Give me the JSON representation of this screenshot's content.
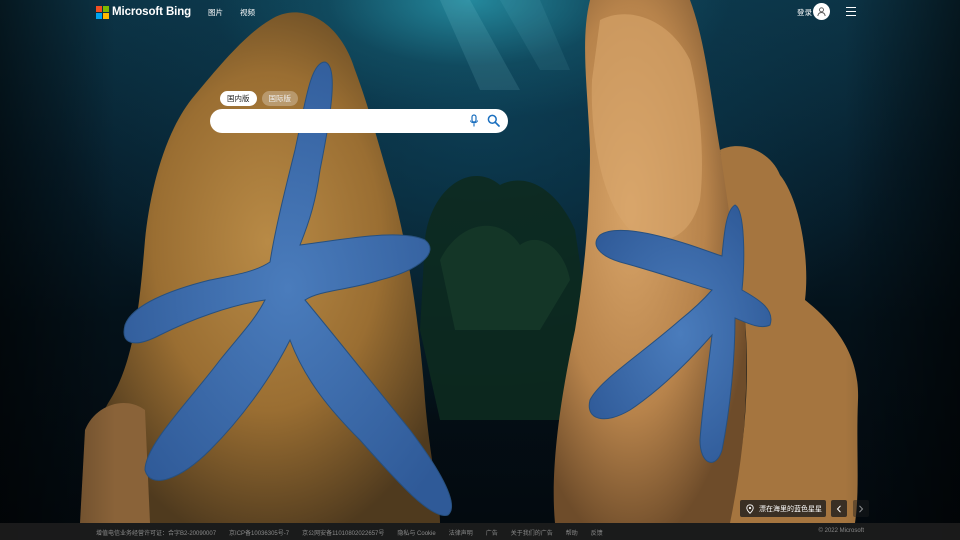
{
  "header": {
    "logo_text": "Microsoft Bing",
    "nav": [
      "图片",
      "视频"
    ],
    "signin_label": "登录",
    "menu_icon": "hamburger-icon",
    "avatar_icon": "user-icon"
  },
  "search": {
    "scope_tabs": [
      "国内版",
      "国际版"
    ],
    "active_scope": "国内版",
    "query": "",
    "mic_icon": "microphone-icon",
    "search_icon": "search-icon"
  },
  "image_info": {
    "caption": "漂在海里的蓝色星星",
    "location_icon": "location-pin-icon",
    "prev_icon": "chevron-left-icon",
    "next_icon": "chevron-right-icon"
  },
  "footer": {
    "links": [
      "增值电信业务经营许可证：合字B2-20090007",
      "京ICP备10036305号-7",
      "京公网安备11010802022657号",
      "隐私与 Cookie",
      "法律声明",
      "广告",
      "关于我们的广告",
      "帮助",
      "反馈"
    ],
    "copyright": "© 2022 Microsoft"
  },
  "colors": {
    "logo_red": "#f25022",
    "logo_green": "#7fba00",
    "logo_blue": "#00a4ef",
    "logo_yellow": "#ffb900",
    "search_icon_blue": "#1a6fbf",
    "starfish_blue": "#3e6fae"
  }
}
